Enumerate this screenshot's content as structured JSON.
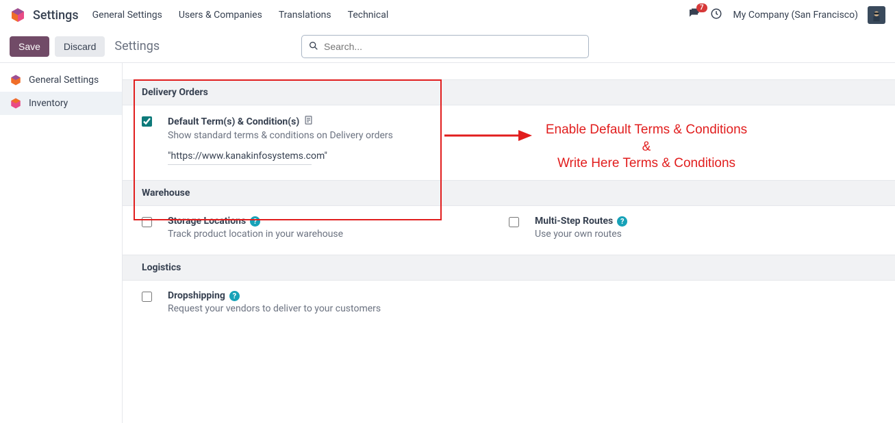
{
  "header": {
    "app_title": "Settings",
    "menu": [
      "General Settings",
      "Users & Companies",
      "Translations",
      "Technical"
    ],
    "messages_badge": "7",
    "company": "My Company (San Francisco)"
  },
  "controlbar": {
    "save_label": "Save",
    "discard_label": "Discard",
    "breadcrumb": "Settings",
    "search_placeholder": "Search..."
  },
  "sidebar": {
    "items": [
      {
        "label": "General Settings"
      },
      {
        "label": "Inventory"
      }
    ],
    "active_index": 1
  },
  "sections": {
    "delivery_orders": {
      "title": "Delivery Orders",
      "setting": {
        "checked": true,
        "title": "Default Term(s) & Condition(s)",
        "desc": "Show standard terms & conditions on Delivery orders",
        "value": "\"https://www.kanakinfosystems.com\""
      }
    },
    "warehouse": {
      "title": "Warehouse",
      "left": {
        "checked": false,
        "title": "Storage Locations",
        "desc": "Track product location in your warehouse"
      },
      "right": {
        "checked": false,
        "title": "Multi-Step Routes",
        "desc": "Use your own routes"
      }
    },
    "logistics": {
      "title": "Logistics",
      "left": {
        "checked": false,
        "title": "Dropshipping",
        "desc": "Request your vendors to deliver to your customers"
      }
    }
  },
  "annotation": {
    "line1": "Enable Default Terms & Conditions",
    "amp": "&",
    "line2": "Write Here Terms & Conditions"
  }
}
